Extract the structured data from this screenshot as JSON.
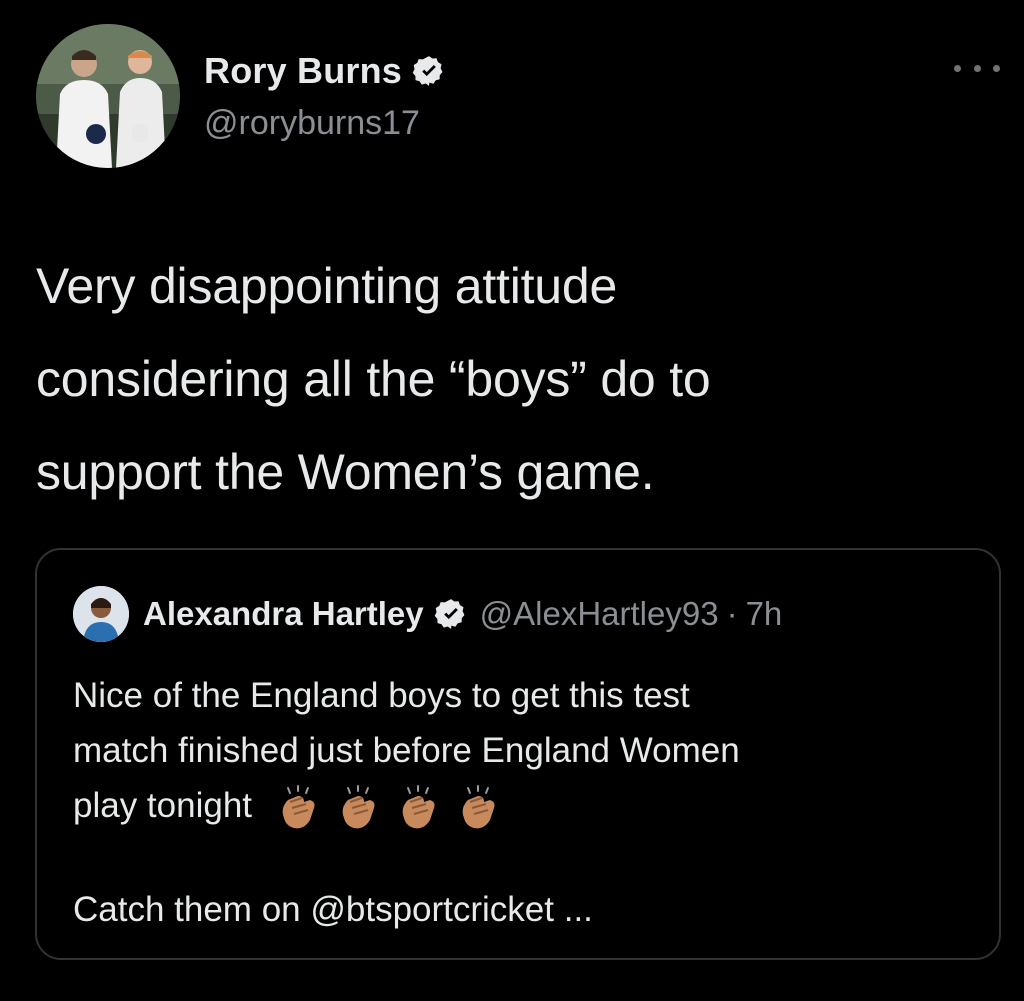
{
  "author": {
    "display_name": "Rory Burns",
    "handle": "@roryburns17",
    "verified": true,
    "avatar_icon": "profile-photo-two-cricketers"
  },
  "tweet": {
    "text": "Very disappointing attitude\nconsidering all the “boys” do to\nsupport the Women’s game."
  },
  "quoted_tweet": {
    "author_name": "Alexandra Hartley",
    "author_handle": "@AlexHartley93",
    "separator": "·",
    "time": "7h",
    "verified": true,
    "text_lines": [
      "Nice of the England boys to get this test",
      "match finished just before England Women",
      "play tonight"
    ],
    "emoji": [
      "clapping-hands",
      "clapping-hands",
      "clapping-hands",
      "clapping-hands"
    ],
    "footer": "Catch them on @btsportcricket ..."
  },
  "colors": {
    "background": "#000000",
    "text_primary": "#e7e9ea",
    "text_secondary": "#8b8f93",
    "border": "#2f3336",
    "verified_badge": "#e7e9ea"
  }
}
